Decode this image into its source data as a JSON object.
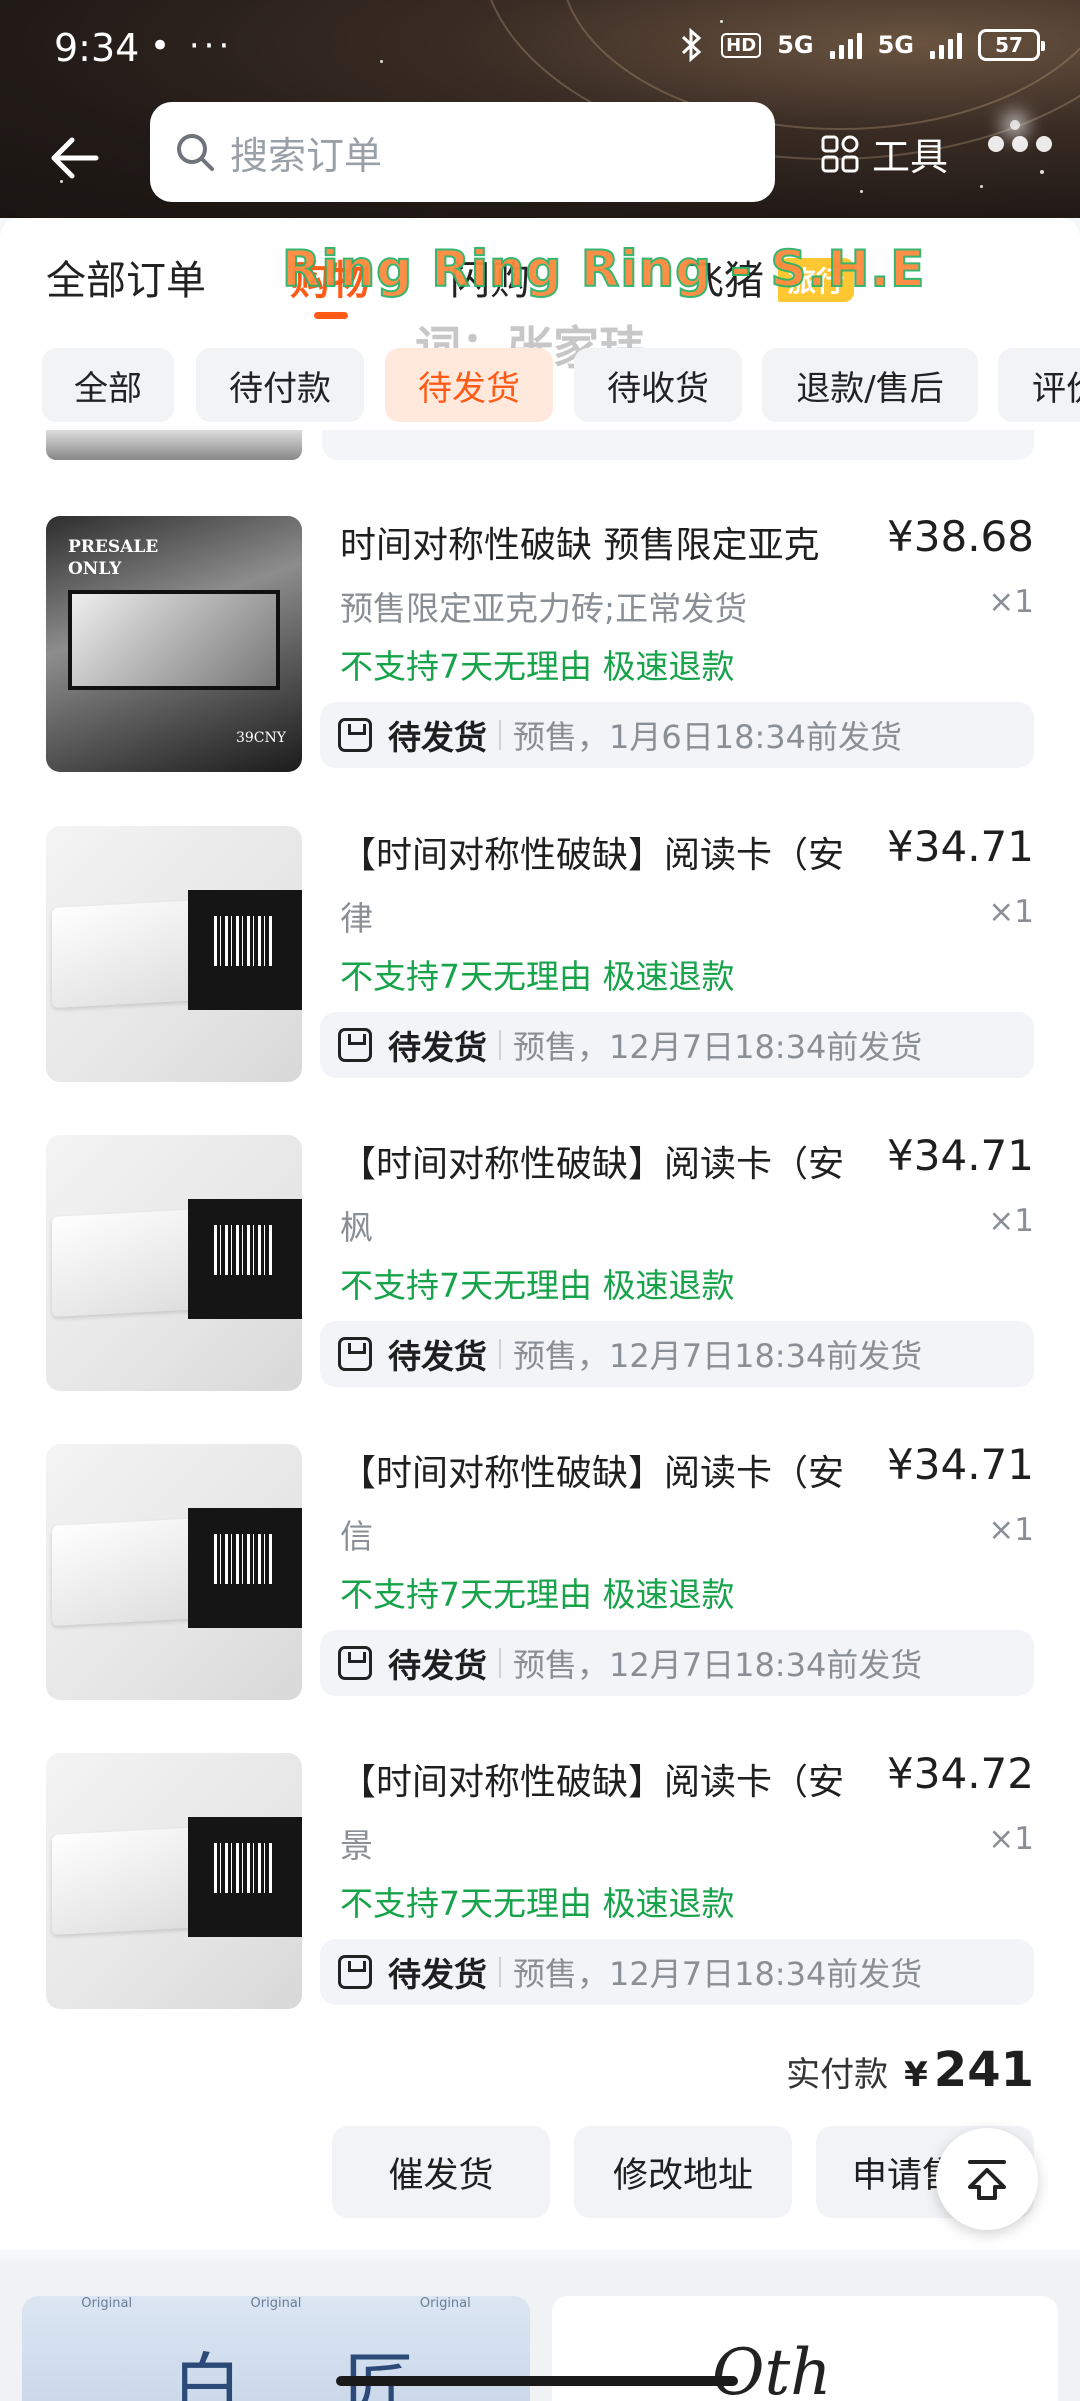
{
  "status_bar": {
    "time": "9:34",
    "dots": "• ···",
    "hd": "HD",
    "net1": "5G",
    "net2": "5G",
    "battery": "57"
  },
  "nav": {
    "search_placeholder": "搜索订单",
    "tools_label": "工具"
  },
  "tabs": [
    {
      "label": "全部订单",
      "active": false
    },
    {
      "label": "购物",
      "active": true
    },
    {
      "label": "闪购",
      "active": false
    },
    {
      "label": "飞猪",
      "active": false
    }
  ],
  "tab_badge": "旅行",
  "overlay": {
    "lyric_line1": "Ring Ring Ring - S.H.E",
    "lyric_line2": "词：张家玮"
  },
  "filter_chips": [
    {
      "label": "全部",
      "active": false
    },
    {
      "label": "待付款",
      "active": false
    },
    {
      "label": "待发货",
      "active": true
    },
    {
      "label": "待收货",
      "active": false
    },
    {
      "label": "退款/售后",
      "active": false
    },
    {
      "label": "评价",
      "active": false
    }
  ],
  "items": [
    {
      "title": "时间对称性破缺 预售限定亚克",
      "price": "¥38.68",
      "spec": "预售限定亚克力砖;正常发货",
      "qty": "×1",
      "policy": "不支持7天无理由  极速退款",
      "status": "待发货",
      "ship_note": "预售，1月6日18:34前发货",
      "thumb": {
        "kind": "acrylic",
        "text1": "PRESALE",
        "text2": "ONLY",
        "text3": "39CNY"
      }
    },
    {
      "title": "【时间对称性破缺】阅读卡（安",
      "price": "¥34.71",
      "spec": "律",
      "qty": "×1",
      "policy": "不支持7天无理由  极速退款",
      "status": "待发货",
      "ship_note": "预售，12月7日18:34前发货",
      "thumb": {
        "kind": "card"
      }
    },
    {
      "title": "【时间对称性破缺】阅读卡（安",
      "price": "¥34.71",
      "spec": "枫",
      "qty": "×1",
      "policy": "不支持7天无理由  极速退款",
      "status": "待发货",
      "ship_note": "预售，12月7日18:34前发货",
      "thumb": {
        "kind": "card"
      }
    },
    {
      "title": "【时间对称性破缺】阅读卡（安",
      "price": "¥34.71",
      "spec": "信",
      "qty": "×1",
      "policy": "不支持7天无理由  极速退款",
      "status": "待发货",
      "ship_note": "预售，12月7日18:34前发货",
      "thumb": {
        "kind": "card"
      }
    },
    {
      "title": "【时间对称性破缺】阅读卡（安",
      "price": "¥34.72",
      "spec": "景",
      "qty": "×1",
      "policy": "不支持7天无理由  极速退款",
      "status": "待发货",
      "ship_note": "预售，12月7日18:34前发货",
      "thumb": {
        "kind": "card"
      }
    }
  ],
  "total": {
    "label": "实付款",
    "currency": "¥",
    "value": "241"
  },
  "actions": [
    {
      "label": "催发货"
    },
    {
      "label": "修改地址"
    },
    {
      "label": "申请售后"
    }
  ],
  "recs": {
    "ribbon": "Original",
    "rec1_text": "白 匠",
    "rec2_text": "Oth"
  },
  "colors": {
    "accent": "#ff5b16",
    "policy_green": "#17a34a",
    "badge_yellow": "#ffc833"
  }
}
